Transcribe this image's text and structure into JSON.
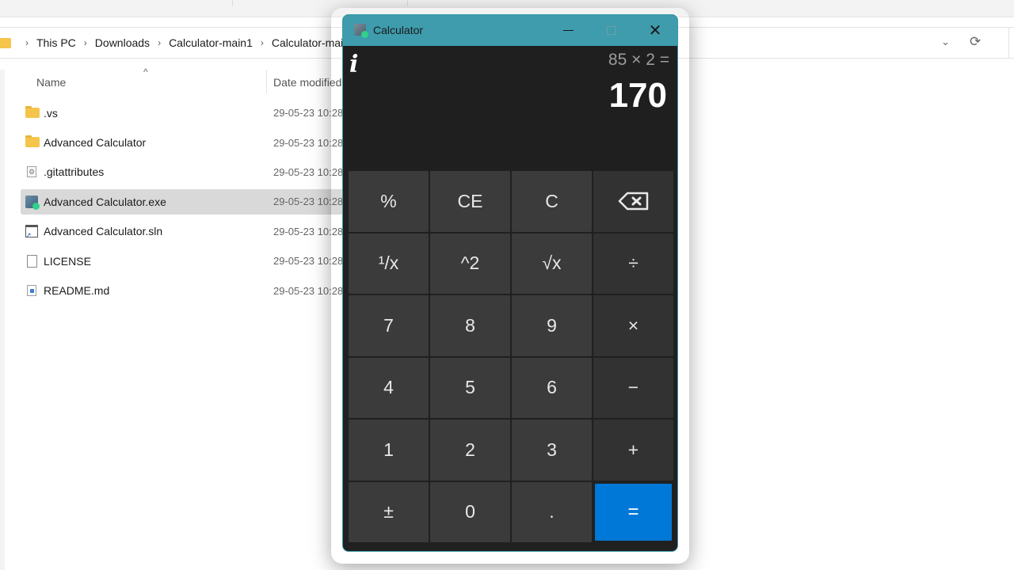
{
  "explorer": {
    "breadcrumb": [
      "This PC",
      "Downloads",
      "Calculator-main1",
      "Calculator-main"
    ],
    "columns": {
      "name": "Name",
      "date_modified": "Date modified"
    },
    "files": [
      {
        "name": ".vs",
        "type": "folder",
        "date": "29-05-23 10:28",
        "selected": false
      },
      {
        "name": "Advanced Calculator",
        "type": "folder",
        "date": "29-05-23 10:28",
        "selected": false
      },
      {
        "name": ".gitattributes",
        "type": "config-file",
        "date": "29-05-23 10:28",
        "selected": false
      },
      {
        "name": "Advanced Calculator.exe",
        "type": "executable",
        "date": "29-05-23 10:28",
        "selected": true
      },
      {
        "name": "Advanced Calculator.sln",
        "type": "solution-file",
        "date": "29-05-23 10:28",
        "selected": false
      },
      {
        "name": "LICENSE",
        "type": "text-file",
        "date": "29-05-23 10:28",
        "selected": false
      },
      {
        "name": "README.md",
        "type": "markdown-file",
        "date": "29-05-23 10:28",
        "selected": false
      }
    ],
    "icons": {
      "chevron": "⌄",
      "refresh": "⟳",
      "sort": "^",
      "crumb_sep": "›"
    }
  },
  "calculator": {
    "title": "Calculator",
    "controls": {
      "minimize": "minimize",
      "maximize": "maximize",
      "close": "✕"
    },
    "info_icon": "i",
    "expression": "85 × 2 =",
    "result": "170",
    "accent_color": "#0078d7",
    "titlebar_color": "#3e9cad",
    "keys": [
      {
        "label": "%",
        "name": "percent-key",
        "kind": "fn"
      },
      {
        "label": "CE",
        "name": "clear-entry-key",
        "kind": "fn"
      },
      {
        "label": "C",
        "name": "clear-key",
        "kind": "fn"
      },
      {
        "label": "",
        "name": "backspace-key",
        "kind": "backspace"
      },
      {
        "label": "¹/x",
        "name": "reciprocal-key",
        "kind": "fn"
      },
      {
        "label": "^2",
        "name": "square-key",
        "kind": "fn"
      },
      {
        "label": "√x",
        "name": "square-root-key",
        "kind": "fn"
      },
      {
        "label": "÷",
        "name": "divide-key",
        "kind": "op"
      },
      {
        "label": "7",
        "name": "digit-7-key",
        "kind": "num"
      },
      {
        "label": "8",
        "name": "digit-8-key",
        "kind": "num"
      },
      {
        "label": "9",
        "name": "digit-9-key",
        "kind": "num"
      },
      {
        "label": "×",
        "name": "multiply-key",
        "kind": "op"
      },
      {
        "label": "4",
        "name": "digit-4-key",
        "kind": "num"
      },
      {
        "label": "5",
        "name": "digit-5-key",
        "kind": "num"
      },
      {
        "label": "6",
        "name": "digit-6-key",
        "kind": "num"
      },
      {
        "label": "−",
        "name": "subtract-key",
        "kind": "op"
      },
      {
        "label": "1",
        "name": "digit-1-key",
        "kind": "num"
      },
      {
        "label": "2",
        "name": "digit-2-key",
        "kind": "num"
      },
      {
        "label": "3",
        "name": "digit-3-key",
        "kind": "num"
      },
      {
        "label": "+",
        "name": "add-key",
        "kind": "op"
      },
      {
        "label": "±",
        "name": "negate-key",
        "kind": "num"
      },
      {
        "label": "0",
        "name": "digit-0-key",
        "kind": "num"
      },
      {
        "label": ".",
        "name": "decimal-key",
        "kind": "num"
      },
      {
        "label": "=",
        "name": "equals-key",
        "kind": "eq"
      }
    ]
  }
}
